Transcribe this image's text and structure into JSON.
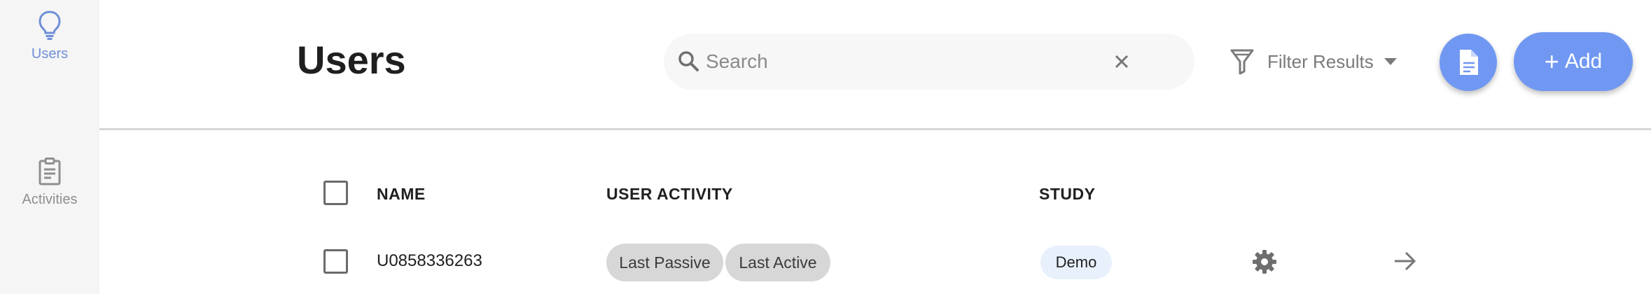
{
  "sidebar": {
    "items": [
      {
        "label": "Users",
        "icon": "lightbulb-icon",
        "active": true
      },
      {
        "label": "Activities",
        "icon": "clipboard-icon",
        "active": false
      }
    ]
  },
  "header": {
    "title": "Users",
    "search": {
      "placeholder": "Search",
      "value": ""
    },
    "filter_label": "Filter Results",
    "add_label": "Add"
  },
  "table": {
    "columns": [
      "NAME",
      "USER ACTIVITY",
      "STUDY"
    ],
    "rows": [
      {
        "name": "U0858336263",
        "activity": [
          "Last Passive",
          "Last Active"
        ],
        "study": "Demo"
      }
    ]
  },
  "colors": {
    "accent": "#7098f2",
    "sidebar_bg": "#f5f5f5",
    "chip_bg": "#d7d7d7",
    "study_badge_bg": "#e8f0fc"
  }
}
